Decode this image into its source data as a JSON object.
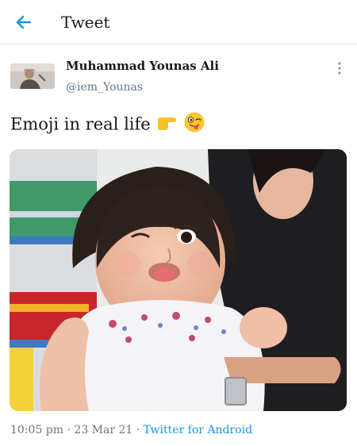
{
  "header": {
    "title": "Tweet",
    "back_icon": "arrow-left-icon",
    "accent": "#1b95e0"
  },
  "author": {
    "name": "Muhammad Younas Ali",
    "handle": "@iem_Younas",
    "more_icon": "vertical-dots-icon"
  },
  "tweet": {
    "text": "Emoji in real life",
    "emojis": [
      "pointing-right-emoji",
      "winking-face-tongue-emoji"
    ]
  },
  "meta": {
    "time": "10:05 pm",
    "sep1": " · ",
    "date": "23 Mar 21",
    "sep2": " · ",
    "source": "Twitter for Android"
  }
}
